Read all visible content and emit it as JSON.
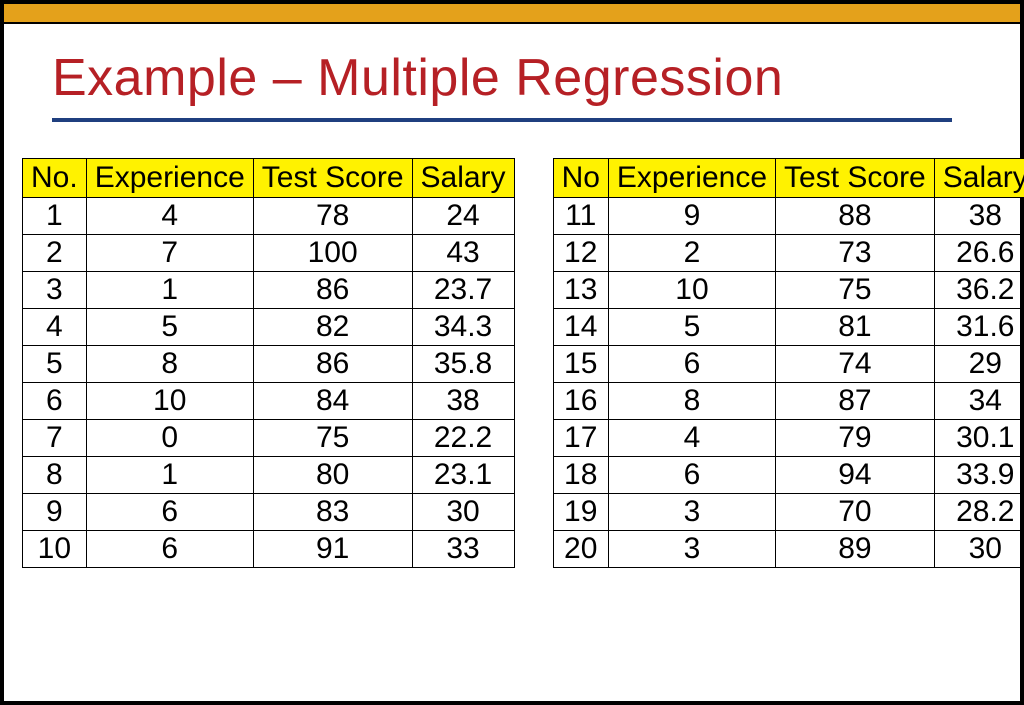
{
  "title": "Example – Multiple Regression",
  "table1": {
    "headers": {
      "no": "No.",
      "exp": "Experience",
      "ts": "Test Score",
      "sal": "Salary"
    },
    "rows": [
      {
        "no": "1",
        "exp": "4",
        "ts": "78",
        "sal": "24"
      },
      {
        "no": "2",
        "exp": "7",
        "ts": "100",
        "sal": "43"
      },
      {
        "no": "3",
        "exp": "1",
        "ts": "86",
        "sal": "23.7"
      },
      {
        "no": "4",
        "exp": "5",
        "ts": "82",
        "sal": "34.3"
      },
      {
        "no": "5",
        "exp": "8",
        "ts": "86",
        "sal": "35.8"
      },
      {
        "no": "6",
        "exp": "10",
        "ts": "84",
        "sal": "38"
      },
      {
        "no": "7",
        "exp": "0",
        "ts": "75",
        "sal": "22.2"
      },
      {
        "no": "8",
        "exp": "1",
        "ts": "80",
        "sal": "23.1"
      },
      {
        "no": "9",
        "exp": "6",
        "ts": "83",
        "sal": "30"
      },
      {
        "no": "10",
        "exp": "6",
        "ts": "91",
        "sal": "33"
      }
    ]
  },
  "table2": {
    "headers": {
      "no": "No",
      "exp": "Experience",
      "ts": "Test Score",
      "sal": "Salary"
    },
    "rows": [
      {
        "no": "11",
        "exp": "9",
        "ts": "88",
        "sal": "38"
      },
      {
        "no": "12",
        "exp": "2",
        "ts": "73",
        "sal": "26.6"
      },
      {
        "no": "13",
        "exp": "10",
        "ts": "75",
        "sal": "36.2"
      },
      {
        "no": "14",
        "exp": "5",
        "ts": "81",
        "sal": "31.6"
      },
      {
        "no": "15",
        "exp": "6",
        "ts": "74",
        "sal": "29"
      },
      {
        "no": "16",
        "exp": "8",
        "ts": "87",
        "sal": "34"
      },
      {
        "no": "17",
        "exp": "4",
        "ts": "79",
        "sal": "30.1"
      },
      {
        "no": "18",
        "exp": "6",
        "ts": "94",
        "sal": "33.9"
      },
      {
        "no": "19",
        "exp": "3",
        "ts": "70",
        "sal": "28.2"
      },
      {
        "no": "20",
        "exp": "3",
        "ts": "89",
        "sal": "30"
      }
    ]
  },
  "chart_data": {
    "type": "table",
    "title": "Example – Multiple Regression",
    "columns": [
      "No",
      "Experience",
      "Test Score",
      "Salary"
    ],
    "rows": [
      [
        1,
        4,
        78,
        24
      ],
      [
        2,
        7,
        100,
        43
      ],
      [
        3,
        1,
        86,
        23.7
      ],
      [
        4,
        5,
        82,
        34.3
      ],
      [
        5,
        8,
        86,
        35.8
      ],
      [
        6,
        10,
        84,
        38
      ],
      [
        7,
        0,
        75,
        22.2
      ],
      [
        8,
        1,
        80,
        23.1
      ],
      [
        9,
        6,
        83,
        30
      ],
      [
        10,
        6,
        91,
        33
      ],
      [
        11,
        9,
        88,
        38
      ],
      [
        12,
        2,
        73,
        26.6
      ],
      [
        13,
        10,
        75,
        36.2
      ],
      [
        14,
        5,
        81,
        31.6
      ],
      [
        15,
        6,
        74,
        29
      ],
      [
        16,
        8,
        87,
        34
      ],
      [
        17,
        4,
        79,
        30.1
      ],
      [
        18,
        6,
        94,
        33.9
      ],
      [
        19,
        3,
        70,
        28.2
      ],
      [
        20,
        3,
        89,
        30
      ]
    ]
  }
}
